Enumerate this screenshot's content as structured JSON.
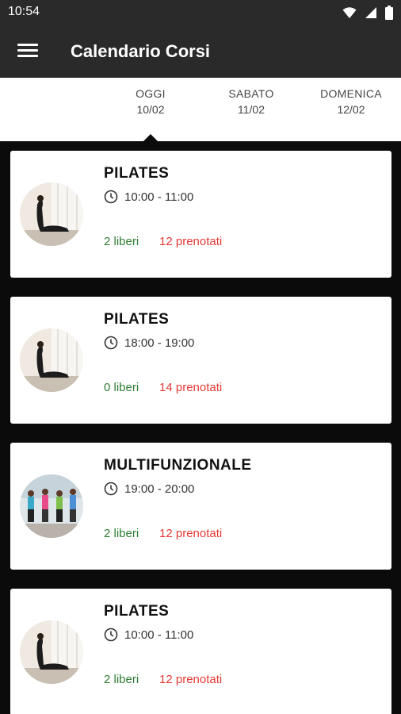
{
  "status": {
    "time": "10:54"
  },
  "appbar": {
    "title": "Calendario Corsi"
  },
  "tabs": [
    {
      "name": "OGGI",
      "date": "10/02"
    },
    {
      "name": "SABATO",
      "date": "11/02"
    },
    {
      "name": "DOMENICA",
      "date": "12/02"
    }
  ],
  "courses": [
    {
      "title": "PILATES",
      "time": "10:00 - 11:00",
      "free": "2 liberi",
      "booked": "12 prenotati",
      "image": "pilates"
    },
    {
      "title": "PILATES",
      "time": "18:00 - 19:00",
      "free": "0 liberi",
      "booked": "14 prenotati",
      "image": "pilates"
    },
    {
      "title": "MULTIFUNZIONALE",
      "time": "19:00 - 20:00",
      "free": "2 liberi",
      "booked": "12 prenotati",
      "image": "multifunctional"
    },
    {
      "title": "PILATES",
      "time": "10:00 - 11:00",
      "free": "2 liberi",
      "booked": "12 prenotati",
      "image": "pilates"
    }
  ],
  "icons": {
    "menu": "hamburger-menu-icon",
    "clock": "clock-icon",
    "wifi": "wifi-icon",
    "signal": "cellular-signal-icon",
    "battery": "battery-icon"
  },
  "colors": {
    "appbar": "#2a2a2a",
    "background": "#0b0b0b",
    "free": "#2e7d32",
    "booked": "#e53935"
  }
}
